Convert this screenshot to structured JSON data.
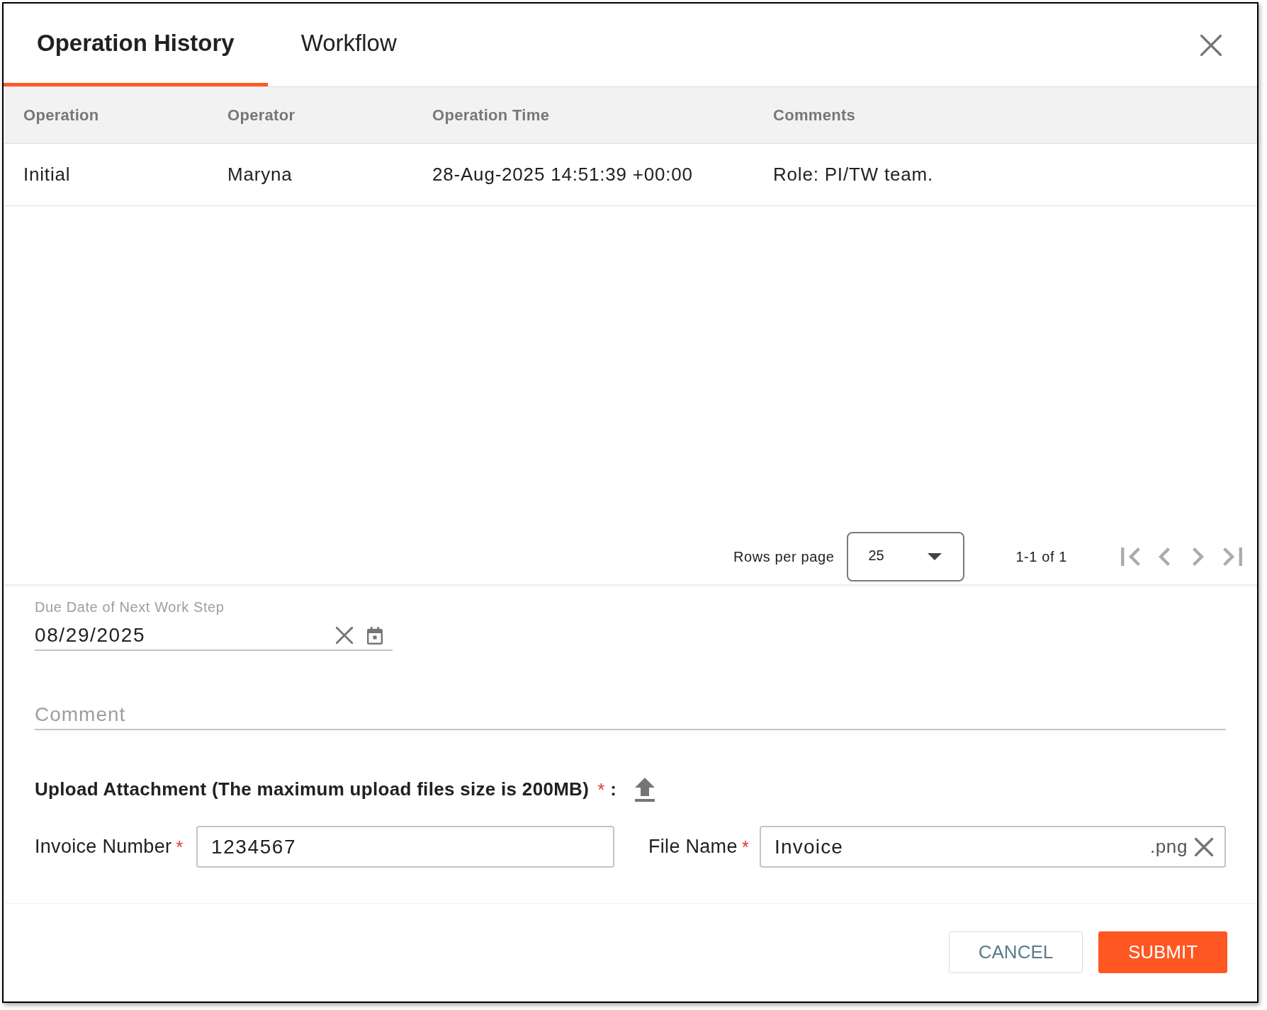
{
  "tabs": [
    {
      "label": "Operation History",
      "selected": true
    },
    {
      "label": "Workflow",
      "selected": false
    }
  ],
  "table": {
    "columns": [
      "Operation",
      "Operator",
      "Operation Time",
      "Comments"
    ],
    "rows": [
      [
        "Initial",
        "Maryna",
        "28-Aug-2025 14:51:39 +00:00",
        "Role: PI/TW team."
      ]
    ]
  },
  "pagination": {
    "rows_per_page_label": "Rows per page",
    "rows_per_page": "25",
    "range": "1-1 of 1",
    "navigation_disabled": true
  },
  "due_date": {
    "label": "Due Date of Next Work Step",
    "value": "08/29/2025"
  },
  "comment": {
    "placeholder": "Comment"
  },
  "upload": {
    "label": "Upload Attachment (The maximum upload files size is 200MB)",
    "required_mark": "*",
    "separator": ":"
  },
  "invoice_number": {
    "label": "Invoice Number",
    "required_mark": "*",
    "value": "1234567"
  },
  "file_name": {
    "label": "File Name",
    "required_mark": "*",
    "value": "Invoice",
    "extension": ".png"
  },
  "buttons": [
    {
      "label": "CANCEL",
      "kind": "secondary"
    },
    {
      "label": "SUBMIT",
      "kind": "primary"
    }
  ]
}
